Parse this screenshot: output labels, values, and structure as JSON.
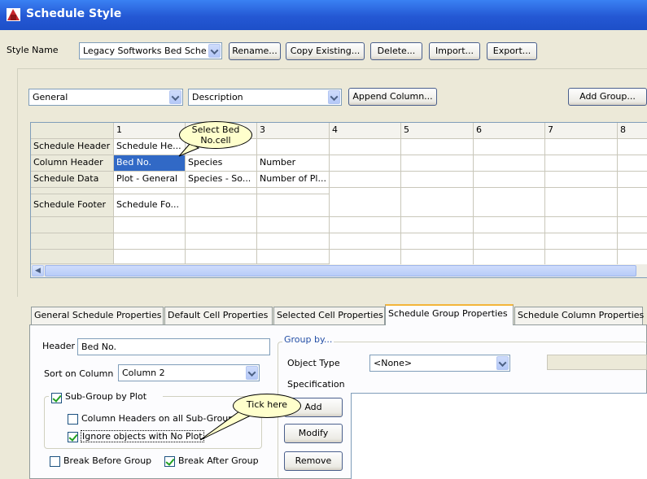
{
  "window": {
    "title": "Schedule Style"
  },
  "style_row": {
    "label": "Style Name",
    "style_value": "Legacy Softworks Bed Sche",
    "buttons": [
      "Rename...",
      "Copy Existing...",
      "Delete...",
      "Import...",
      "Export..."
    ]
  },
  "toolbar": {
    "general_value": "General",
    "description_value": "Description",
    "append_column": "Append Column...",
    "add_group": "Add Group..."
  },
  "table": {
    "column_numbers": [
      "1",
      "2",
      "3",
      "4",
      "5",
      "6",
      "7",
      "8"
    ],
    "rows": [
      {
        "label": "Schedule Header",
        "cells": [
          "Schedule He...",
          "",
          ""
        ]
      },
      {
        "label": "Column Header",
        "cells": [
          "Bed No.",
          "Species",
          "Number"
        ]
      },
      {
        "label": "Schedule Data",
        "cells": [
          "Plot - General",
          "Species - So...",
          "Number of Pl..."
        ]
      },
      {
        "label": "",
        "cells": [
          "",
          "",
          ""
        ]
      },
      {
        "label": "Schedule Footer",
        "cells": [
          "Schedule Fo...",
          "",
          ""
        ]
      }
    ]
  },
  "callouts": {
    "select_cell": "Select Bed No.cell",
    "tick_here": "Tick here"
  },
  "tabs": [
    "General Schedule Properties",
    "Default Cell Properties",
    "Selected Cell Properties",
    "Schedule Group Properties",
    "Schedule Column Properties"
  ],
  "active_tab": "Schedule Group Properties",
  "group_panel": {
    "header_label": "Header",
    "header_value": "Bed No.",
    "sort_label": "Sort on Column",
    "sort_value": "Column 2",
    "subgroup_label": "Sub-Group by Plot",
    "col_headers_label": "Column Headers on all Sub-Groups",
    "ignore_label": "Ignore objects with No Plot",
    "break_before_label": "Break Before Group",
    "break_after_label": "Break After Group",
    "group_by_label": "Group by...",
    "object_type_label": "Object Type",
    "object_type_value": "<None>",
    "specification_label": "Specification",
    "add_btn": "Add",
    "modify_btn": "Modify",
    "remove_btn": "Remove"
  },
  "checkbox_states": {
    "subgroup": true,
    "col_headers": false,
    "ignore": true,
    "break_before": false,
    "break_after": true
  },
  "colors": {
    "title_bar": "#2458d4",
    "selection": "#3169c6",
    "callout": "#ffffcc",
    "active_tab_accent": "#f3b53a"
  }
}
